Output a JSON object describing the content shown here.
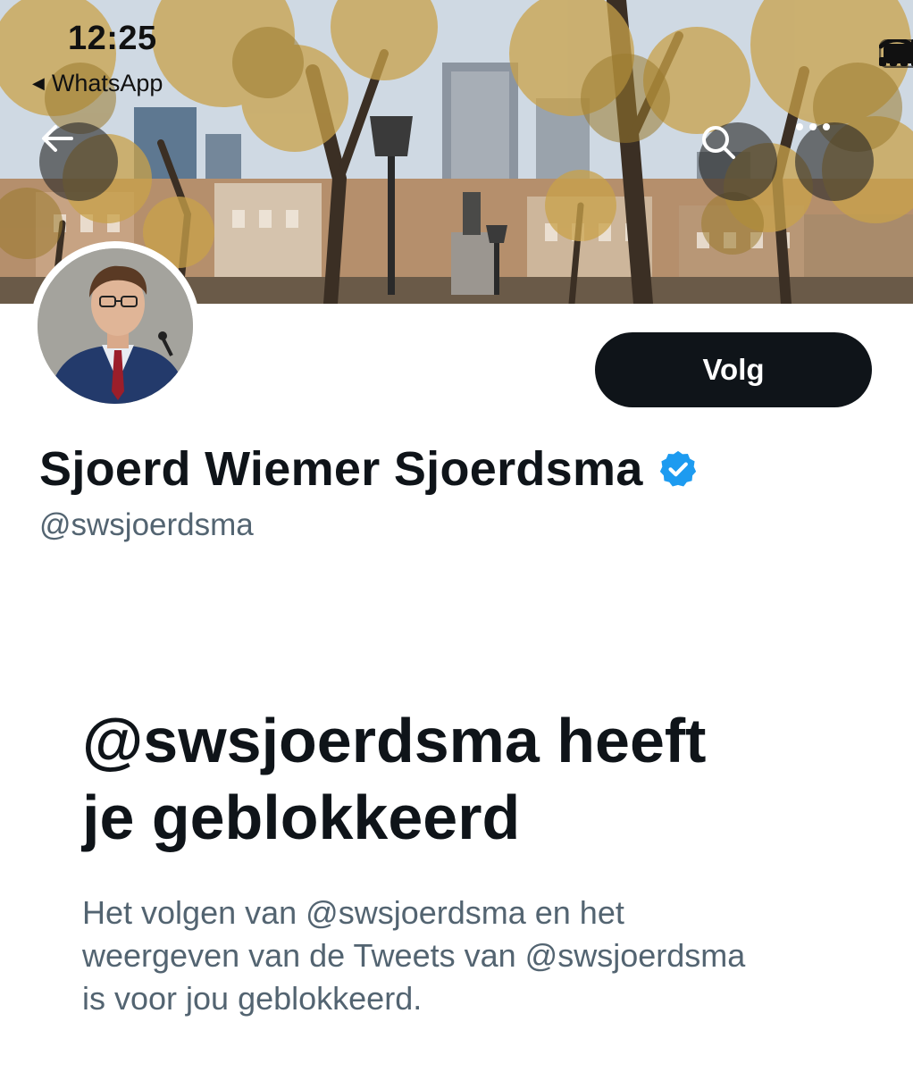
{
  "status_bar": {
    "time": "12:25",
    "back_app_label": "WhatsApp",
    "icons": [
      "cellular-signal-icon",
      "wifi-icon",
      "battery-icon"
    ]
  },
  "header": {
    "back_icon": "arrow-left-icon",
    "search_icon": "search-icon",
    "more_icon": "more-horizontal-icon"
  },
  "profile": {
    "display_name": "Sjoerd Wiemer Sjoerdsma",
    "verified_icon": "verified-badge-icon",
    "handle": "@swsjoerdsma",
    "follow_label": "Volg"
  },
  "blocked": {
    "title_line1": "@swsjoerdsma heeft",
    "title_line2": "je geblokkeerd",
    "description_line1": "Het volgen van @swsjoerdsma en het",
    "description_line2": "weergeven van de Tweets van @swsjoerdsma",
    "description_line3": "is voor jou geblokkeerd."
  },
  "colors": {
    "text_primary": "#0f1419",
    "text_secondary": "#536471",
    "verified_blue": "#1d9bf0",
    "follow_bg": "#0f1419"
  }
}
